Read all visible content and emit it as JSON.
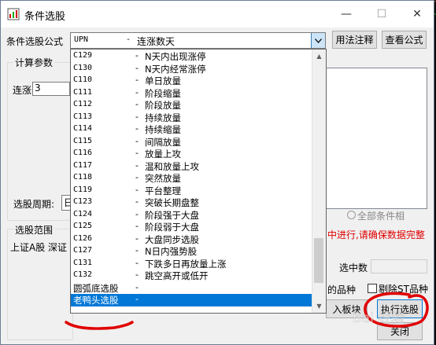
{
  "window": {
    "title": "条件选股"
  },
  "titlebar_buttons": {
    "minimize": "—",
    "maximize": "☐",
    "close": "✕"
  },
  "formula": {
    "label": "条件选股公式",
    "selected_code": "UPN",
    "selected_sep": "-",
    "selected_name": "连涨数天",
    "usage_button": "用法注释",
    "view_button": "查看公式"
  },
  "params": {
    "group_label": "计算参数",
    "lianzhang_label": "连涨",
    "lianzhang_value": "3"
  },
  "period": {
    "label": "选股周期:",
    "value": "日"
  },
  "range": {
    "group_label": "选股范围",
    "markets_text": "上证A股  深证"
  },
  "right": {
    "all_conditions_label": "全部条件相",
    "warning_text": "中进行,请确保数据完整",
    "selected_count_label": "选中数",
    "varieties_label": "的品种",
    "exclude_st_label": "剔除ST品种",
    "add_to_block_button": "入板块",
    "execute_button": "执行选股",
    "close_button": "关闭"
  },
  "dropdown": {
    "items": [
      {
        "code": "C129",
        "sep": "-",
        "name": "N天内出现涨停"
      },
      {
        "code": "C130",
        "sep": "-",
        "name": "N天内经常涨停"
      },
      {
        "code": "C110",
        "sep": "-",
        "name": "单日放量"
      },
      {
        "code": "C111",
        "sep": "-",
        "name": "阶段缩量"
      },
      {
        "code": "C112",
        "sep": "-",
        "name": "阶段放量"
      },
      {
        "code": "C113",
        "sep": "-",
        "name": "持续放量"
      },
      {
        "code": "C114",
        "sep": "-",
        "name": "持续缩量"
      },
      {
        "code": "C115",
        "sep": "-",
        "name": "间隔放量"
      },
      {
        "code": "C116",
        "sep": "-",
        "name": "放量上攻"
      },
      {
        "code": "C117",
        "sep": "-",
        "name": "温和放量上攻"
      },
      {
        "code": "C118",
        "sep": "-",
        "name": "突然放量"
      },
      {
        "code": "C119",
        "sep": "-",
        "name": "平台整理"
      },
      {
        "code": "C123",
        "sep": "-",
        "name": "突破长期盘整"
      },
      {
        "code": "C124",
        "sep": "-",
        "name": "阶段强于大盘"
      },
      {
        "code": "C125",
        "sep": "-",
        "name": "阶段弱于大盘"
      },
      {
        "code": "C126",
        "sep": "-",
        "name": "大盘同步选股"
      },
      {
        "code": "C127",
        "sep": "-",
        "name": "N日内强势股"
      },
      {
        "code": "C131",
        "sep": "-",
        "name": "下跌多日再放量上涨"
      },
      {
        "code": "C132",
        "sep": "-",
        "name": "跳空高开或低开"
      },
      {
        "code": "圆弧底选股",
        "sep": "-",
        "name": ""
      },
      {
        "code": "老鸭头选股",
        "sep": "-",
        "name": ""
      }
    ],
    "selected_index": 20,
    "scroll_thumb_fraction_start": 0.74,
    "scroll_thumb_fraction_size": 0.19
  },
  "watermark": {
    "text": "Bai 经验"
  },
  "colors": {
    "selection": "#0078d7",
    "annotation_red": "#e00000",
    "warning_red": "#e00000"
  }
}
